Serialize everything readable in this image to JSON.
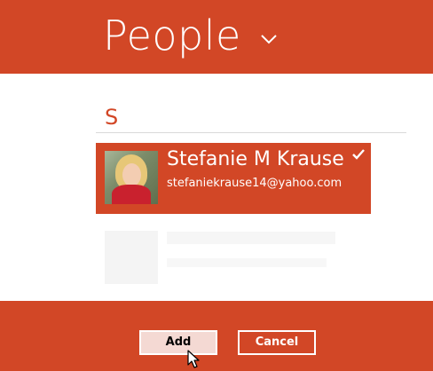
{
  "app": {
    "title": "People",
    "accent_color": "#d24726"
  },
  "content": {
    "section_letter": "S",
    "contacts": [
      {
        "name": "Stefanie M Krause",
        "email": "stefaniekrause14@yahoo.com",
        "selected": true
      }
    ]
  },
  "footer": {
    "add_label": "Add",
    "cancel_label": "Cancel"
  },
  "icons": {
    "title_dropdown": "chevron-down-icon",
    "selected_mark": "checkmark-icon",
    "pointer": "mouse-cursor-icon"
  }
}
